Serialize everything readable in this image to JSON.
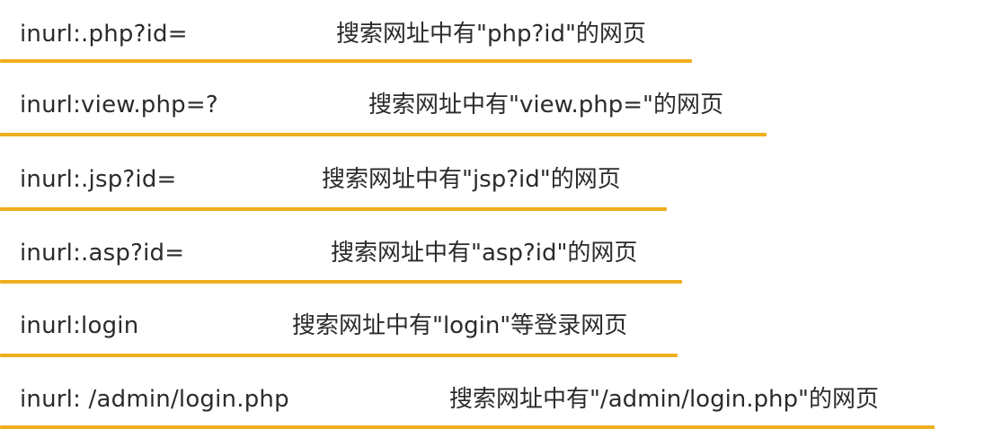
{
  "accent_color": "#f0ad1d",
  "rows": [
    {
      "syntax": "inurl:.php?id=",
      "description": "搜索网址中有\"php?id\"的网页"
    },
    {
      "syntax": "inurl:view.php=?",
      "description": "搜索网址中有\"view.php=\"的网页"
    },
    {
      "syntax": "inurl:.jsp?id=",
      "description": "搜索网址中有\"jsp?id\"的网页"
    },
    {
      "syntax": "inurl:.asp?id=",
      "description": "搜索网址中有\"asp?id\"的网页"
    },
    {
      "syntax": "inurl:login",
      "description": "搜索网址中有\"login\"等登录网页"
    },
    {
      "syntax": "inurl: /admin/login.php",
      "description": "搜索网址中有\"/admin/login.php\"的网页"
    }
  ]
}
